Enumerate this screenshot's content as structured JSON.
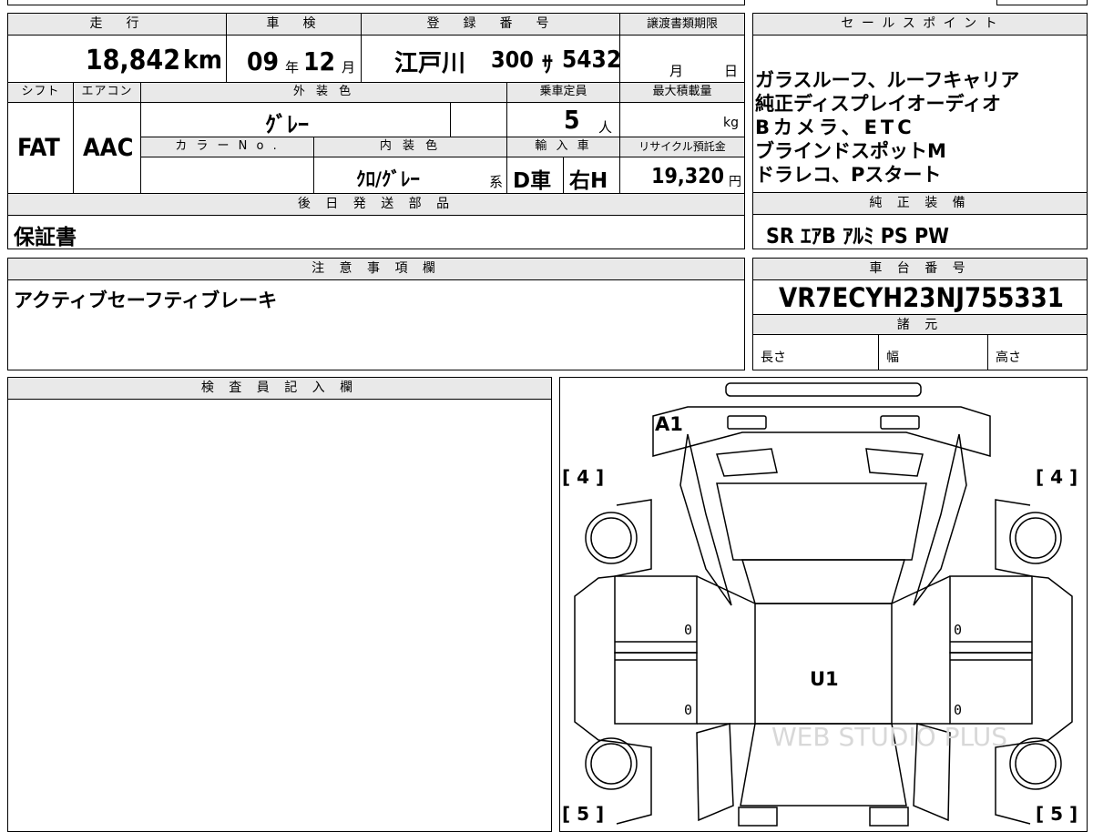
{
  "header": {
    "mileage_label": "走　行",
    "inspection_label": "車　検",
    "registration_label": "登　録　番　号",
    "transfer_doc_label": "譲渡書類期限",
    "sales_point_label": "セ ー ル ス ポ イ ン ト"
  },
  "vehicle": {
    "mileage_value": "18,842",
    "mileage_unit": "km",
    "inspection_year": "09",
    "inspection_year_unit": "年",
    "inspection_month": "12",
    "inspection_month_unit": "月",
    "registration_area": "江戸川",
    "registration_class": "300",
    "registration_kana": "ｻ",
    "registration_number": "5432",
    "transfer_month_unit": "月",
    "transfer_day_unit": "日"
  },
  "row2": {
    "shift_label": "シフト",
    "aircon_label": "エアコン",
    "exterior_color_label": "外 装 色",
    "capacity_label": "乗車定員",
    "max_load_label": "最大積載量",
    "color_no_label": "カ ラ ー N o .",
    "interior_color_label": "内 装 色",
    "import_label": "輸 入 車",
    "recycle_label": "リサイクル預託金"
  },
  "row2_values": {
    "shift": "FAT",
    "aircon": "AAC",
    "exterior_color": "ｸﾞﾚｰ",
    "capacity": "5",
    "capacity_unit": "人",
    "max_load_unit": "kg",
    "interior_color": "ｸﾛ/ｸﾞﾚｰ",
    "interior_suffix": "系",
    "import_type": "D車",
    "steering": "右H",
    "recycle_amount": "19,320",
    "recycle_unit": "円"
  },
  "sales_points": [
    "ガラスルーフ、ルーフキャリア",
    "純正ディスプレイオーディオ",
    "Bカメラ、ETC",
    "ブラインドスポットM",
    "ドラレコ、Pスタート"
  ],
  "later_parts": {
    "label": "後 日 発 送 部 品",
    "value": "保証書"
  },
  "equipment": {
    "label": "純 正 装 備",
    "value": "SR ｴｱB ｱﾙﾐ PS PW"
  },
  "notes": {
    "label": "注 意 事 項 欄",
    "value": "アクティブセーフティブレーキ"
  },
  "chassis": {
    "label": "車 台 番 号",
    "value": "VR7ECYH23NJ755331",
    "spec_label": "諸 元",
    "length_label": "長さ",
    "width_label": "幅",
    "height_label": "高さ"
  },
  "inspector": {
    "label": "検 査 員 記 入 欄"
  },
  "diagram": {
    "roof_code": "A1",
    "body_code": "U1",
    "left_front": "[ 4 ]",
    "right_front": "[ 4 ]",
    "left_rear": "[ 5 ]",
    "right_rear": "[ 5 ]",
    "door_marks": [
      "0",
      "0",
      "0",
      "0"
    ],
    "watermark": "WEB STUDIO PLUS"
  }
}
